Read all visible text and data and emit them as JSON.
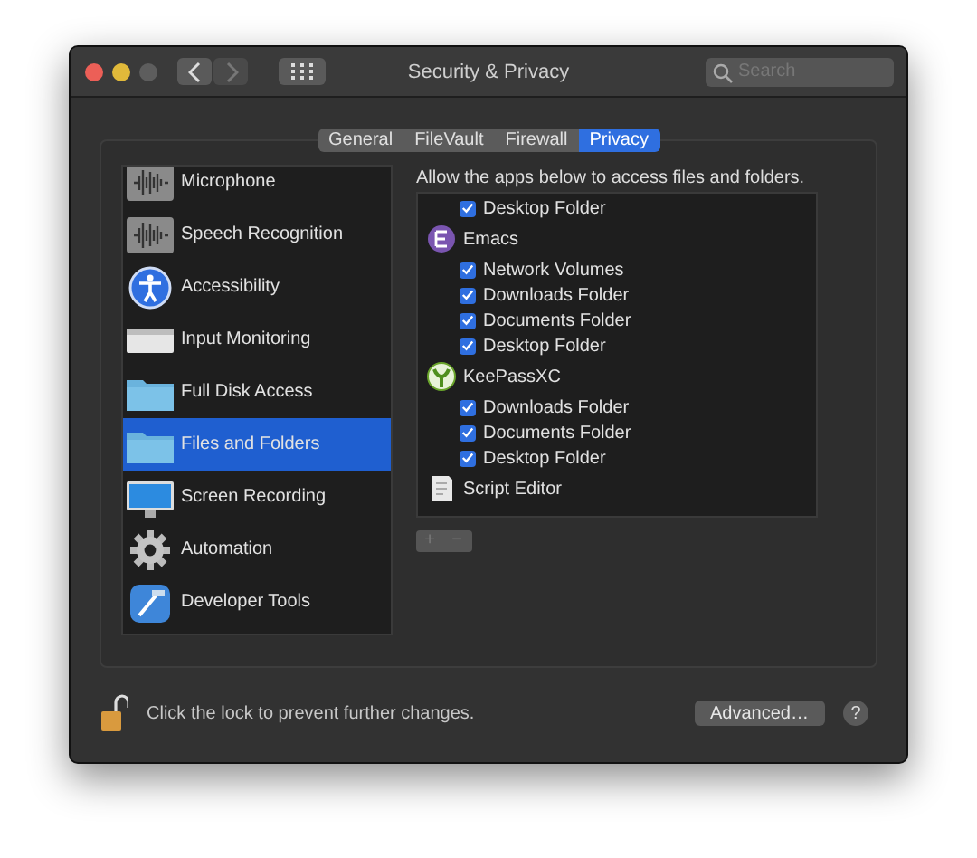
{
  "window": {
    "title": "Security & Privacy"
  },
  "search": {
    "placeholder": "Search"
  },
  "tabs": [
    {
      "label": "General",
      "selected": false
    },
    {
      "label": "FileVault",
      "selected": false
    },
    {
      "label": "Firewall",
      "selected": false
    },
    {
      "label": "Privacy",
      "selected": true
    }
  ],
  "sidebar": {
    "items": [
      {
        "label": "Microphone",
        "kind": "waveform",
        "selected": false
      },
      {
        "label": "Speech Recognition",
        "kind": "waveform",
        "selected": false
      },
      {
        "label": "Accessibility",
        "kind": "accessibility",
        "selected": false
      },
      {
        "label": "Input Monitoring",
        "kind": "keyboard",
        "selected": false
      },
      {
        "label": "Full Disk Access",
        "kind": "folder",
        "selected": false
      },
      {
        "label": "Files and Folders",
        "kind": "folder",
        "selected": true
      },
      {
        "label": "Screen Recording",
        "kind": "display",
        "selected": false
      },
      {
        "label": "Automation",
        "kind": "gear",
        "selected": false
      },
      {
        "label": "Developer Tools",
        "kind": "hammer",
        "selected": false
      }
    ]
  },
  "description": "Allow the apps below to access files and folders.",
  "apps": [
    {
      "permissions": [
        {
          "label": "Desktop Folder",
          "checked": true
        }
      ]
    },
    {
      "name": "Emacs",
      "kind": "emacs",
      "permissions": [
        {
          "label": "Network Volumes",
          "checked": true
        },
        {
          "label": "Downloads Folder",
          "checked": true
        },
        {
          "label": "Documents Folder",
          "checked": true
        },
        {
          "label": "Desktop Folder",
          "checked": true
        }
      ]
    },
    {
      "name": "KeePassXC",
      "kind": "keepass",
      "permissions": [
        {
          "label": "Downloads Folder",
          "checked": true
        },
        {
          "label": "Documents Folder",
          "checked": true
        },
        {
          "label": "Desktop Folder",
          "checked": true
        }
      ]
    },
    {
      "name": "Script Editor",
      "kind": "script"
    }
  ],
  "list_buttons": [
    {
      "label": "+",
      "disabled": true
    },
    {
      "label": "−",
      "disabled": true
    }
  ],
  "footer": {
    "locked": false,
    "text": "Click the lock to prevent further changes.",
    "advanced": "Advanced…",
    "help": "?"
  }
}
